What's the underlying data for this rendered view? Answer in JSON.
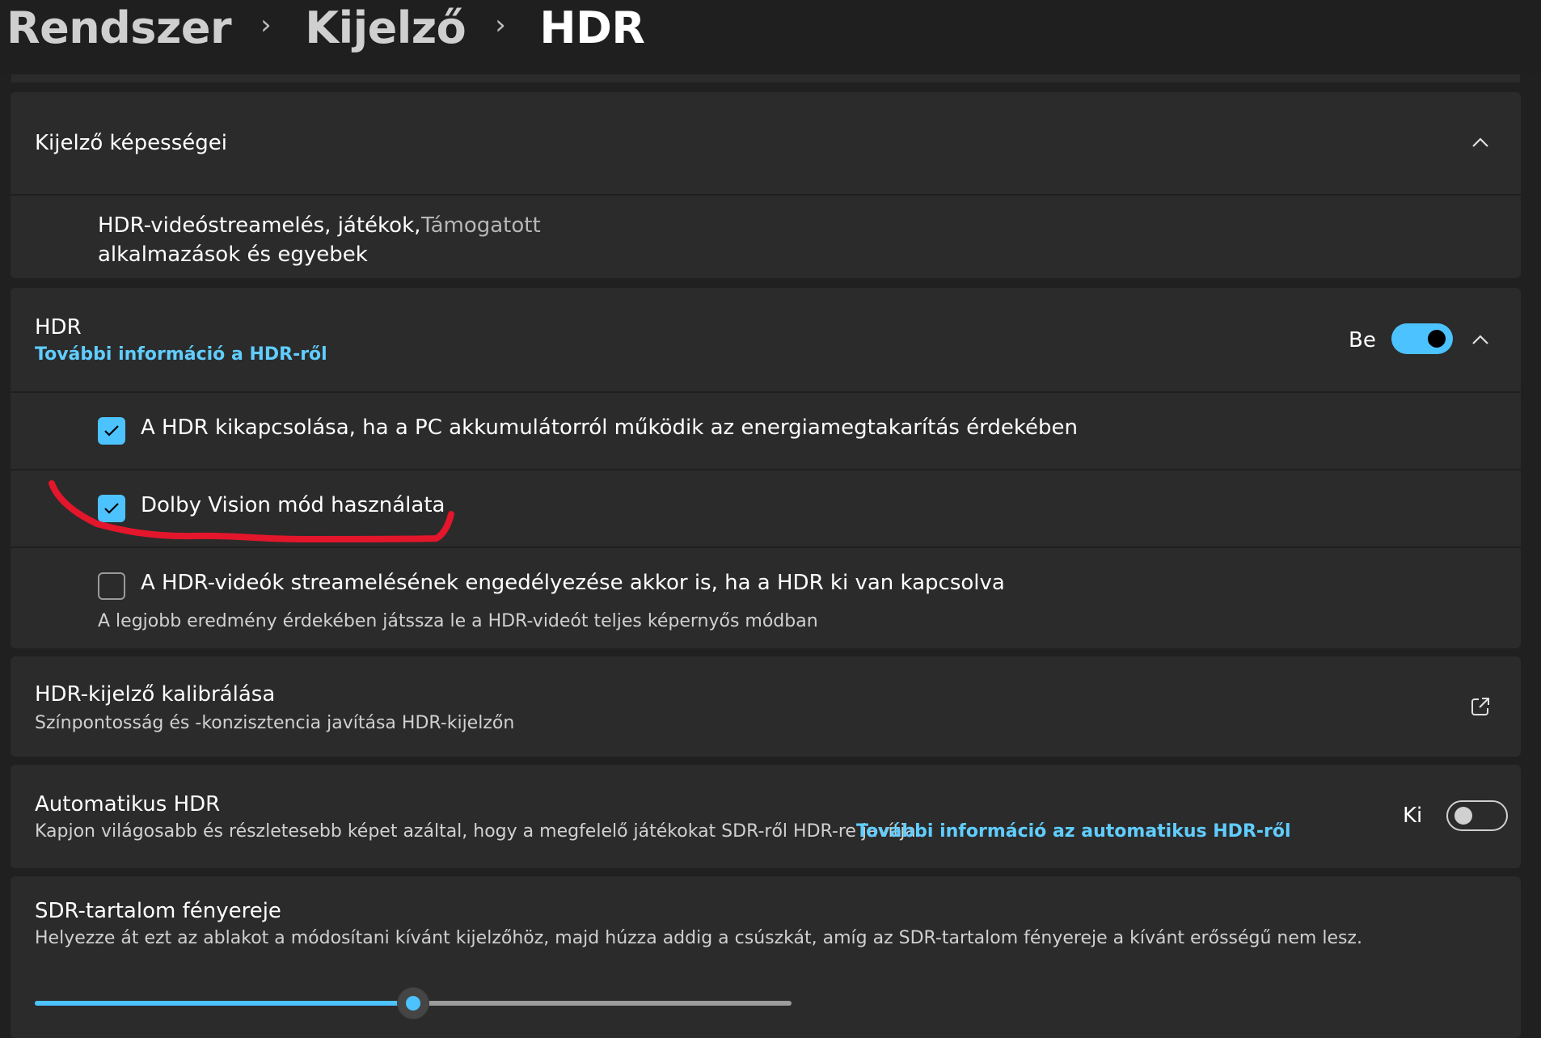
{
  "breadcrumb": {
    "items": [
      "Rendszer",
      "Kijelző",
      "HDR"
    ]
  },
  "display_capabilities": {
    "title": "Kijelző képességei",
    "feature_label": "HDR-videóstreamelés, játékok,\nalkalmazások és egyebek",
    "feature_label_line1": "HDR-videóstreamelés, játékok,",
    "feature_label_line2": "alkalmazások és egyebek",
    "feature_status": "Támogatott"
  },
  "hdr": {
    "title": "HDR",
    "link": "További információ a HDR-ről",
    "toggle_label": "Be",
    "toggle_on": true,
    "options": [
      {
        "label": "A HDR kikapcsolása, ha a PC akkumulátorról működik az energiamegtakarítás érdekében",
        "checked": true
      },
      {
        "label": "Dolby Vision mód használata",
        "checked": true
      },
      {
        "label": "A HDR-videók streamelésének engedélyezése akkor is, ha a HDR ki van kapcsolva",
        "checked": false,
        "description": "A legjobb eredmény érdekében játssza le a HDR-videót teljes képernyős módban"
      }
    ]
  },
  "calibration": {
    "title": "HDR-kijelző kalibrálása",
    "subtitle": "Színpontosság és -konzisztencia javítása HDR-kijelzőn"
  },
  "auto_hdr": {
    "title": "Automatikus HDR",
    "subtitle": "Kapjon világosabb és részletesebb képet azáltal, hogy a megfelelő játékokat SDR-ről HDR-re javítja.",
    "link": "További információ az automatikus HDR-ről",
    "toggle_label": "Ki",
    "toggle_on": false
  },
  "sdr_brightness": {
    "title": "SDR-tartalom fényereje",
    "subtitle": "Helyezze át ezt az ablakot a módosítani kívánt kijelzőhöz, majd húzza addig a csúszkát, amíg az SDR-tartalom fényereje a kívánt erősségű nem lesz.",
    "slider_fraction": 0.5
  },
  "colors": {
    "accent": "#4cc2ff",
    "link": "#60cdff",
    "card": "#2b2b2b",
    "background": "#202020",
    "annotation": "#e3162b"
  }
}
